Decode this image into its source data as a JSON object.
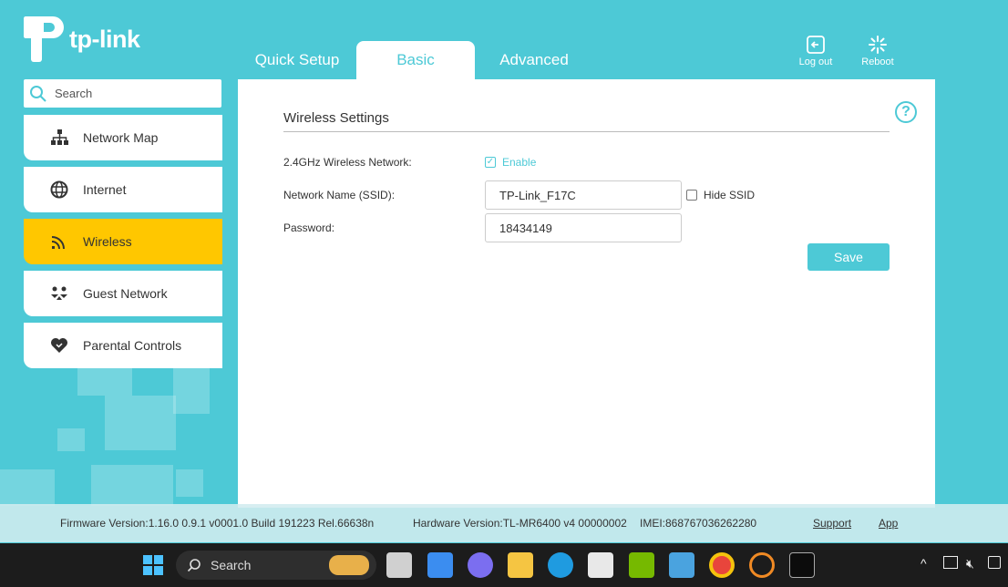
{
  "brand": {
    "name": "tp-link"
  },
  "top_tabs": [
    {
      "label": "Quick Setup"
    },
    {
      "label": "Basic"
    },
    {
      "label": "Advanced"
    }
  ],
  "top_actions": {
    "logout_label": "Log out",
    "reboot_label": "Reboot"
  },
  "search": {
    "placeholder": "Search"
  },
  "sidebar": {
    "items": [
      {
        "label": "Network Map",
        "icon": "network-map-icon"
      },
      {
        "label": "Internet",
        "icon": "globe-icon"
      },
      {
        "label": "Wireless",
        "icon": "wifi-icon",
        "active": true
      },
      {
        "label": "Guest Network",
        "icon": "guest-icon"
      },
      {
        "label": "Parental Controls",
        "icon": "heart-icon"
      }
    ]
  },
  "panel": {
    "title": "Wireless Settings",
    "wireless_label": "2.4GHz Wireless Network:",
    "enable_label": "Enable",
    "enable_checked": true,
    "ssid_label": "Network Name (SSID):",
    "ssid_value": "TP-Link_F17C",
    "hide_ssid_label": "Hide SSID",
    "hide_ssid_checked": false,
    "password_label": "Password:",
    "password_value": "18434149",
    "save_label": "Save"
  },
  "footer": {
    "firmware": "Firmware Version:1.16.0 0.9.1 v0001.0 Build 191223 Rel.66638n",
    "hardware": "Hardware Version:TL-MR6400 v4 00000002",
    "imei": "IMEI:868767036262280",
    "support_label": "Support",
    "app_label": "App"
  },
  "taskbar": {
    "search_label": "Search"
  },
  "colors": {
    "accent": "#4dc9d6",
    "active_item": "#ffc700",
    "taskbar": "#1c1c1c"
  }
}
